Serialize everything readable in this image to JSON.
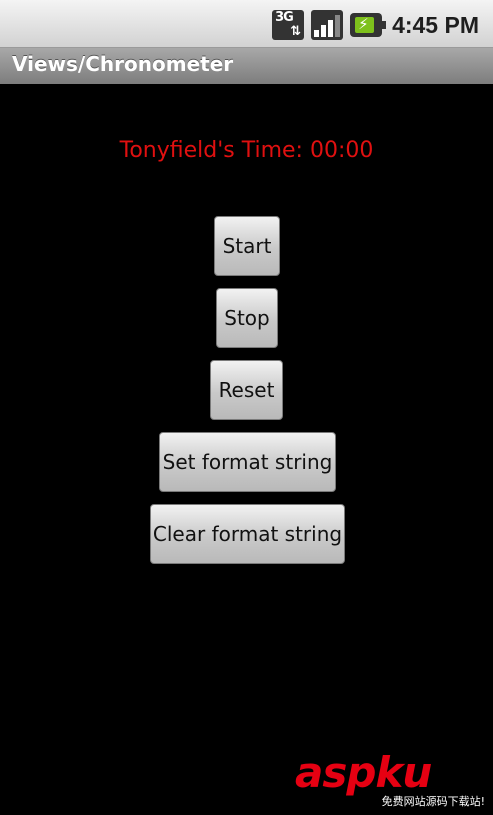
{
  "status_bar": {
    "network_label": "3G",
    "network_arrows": "⇅",
    "battery_bolt": "⚡",
    "time": "4:45 PM",
    "icons": [
      "network-3g-icon",
      "signal-strength-icon",
      "battery-charging-icon"
    ]
  },
  "title_bar": {
    "title": "Views/Chronometer"
  },
  "chronometer": {
    "text": "Tonyfield's Time: 00:00",
    "color": "#e01010"
  },
  "buttons": {
    "start": "Start",
    "stop": "Stop",
    "reset": "Reset",
    "set_format": "Set format string",
    "clear_format": "Clear format string"
  },
  "watermark": {
    "logo": "aspku",
    "tagline": "免费网站源码下载站!",
    "color": "#e60012"
  }
}
